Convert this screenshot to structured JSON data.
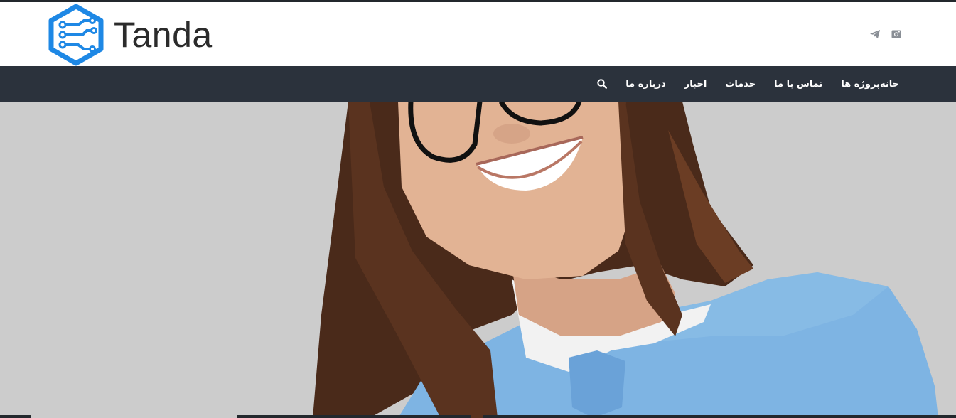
{
  "brand": {
    "name": "Tanda",
    "logo_color": "#1e88e5"
  },
  "social": [
    {
      "name": "telegram"
    },
    {
      "name": "instagram"
    }
  ],
  "nav": {
    "items": [
      {
        "label": "خانه"
      },
      {
        "label": "پروژه ها"
      },
      {
        "label": "تماس با ما"
      },
      {
        "label": "خدمات"
      },
      {
        "label": "اخبار"
      },
      {
        "label": "درباره ما"
      }
    ],
    "search_icon": "search-icon"
  },
  "colors": {
    "nav_bg": "#2b323c",
    "hero_bg": "#cccccc",
    "header_bg": "#ffffff"
  }
}
